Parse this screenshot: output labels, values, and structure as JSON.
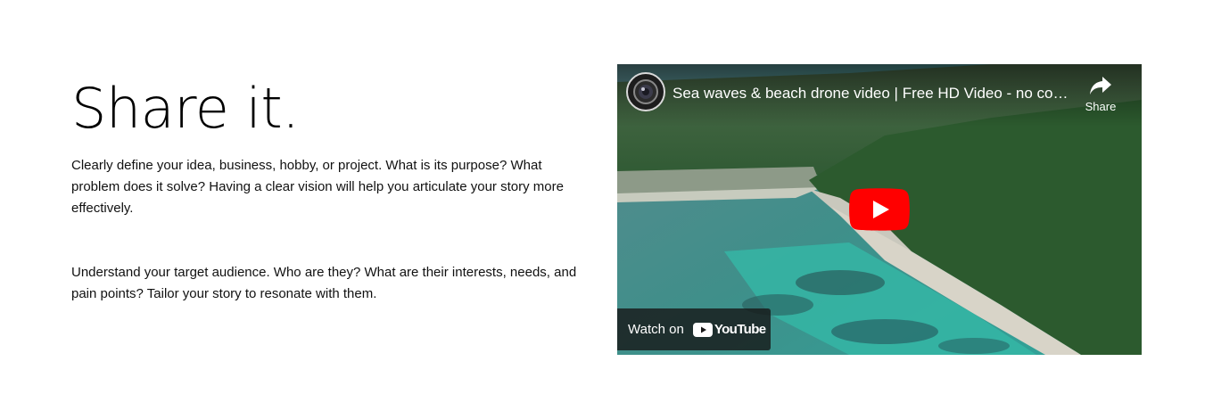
{
  "section": {
    "headline": "Share it.",
    "paragraphs": [
      "Clearly define your idea, business, hobby, or project. What is its purpose? What problem does it solve? Having a clear vision will help you articulate your story more effectively.",
      "Understand your target audience. Who are they? What are their interests, needs, and pain points? Tailor your story to resonate with them."
    ]
  },
  "video": {
    "title": "Sea waves & beach drone video | Free HD Video - no copyright",
    "share_label": "Share",
    "watch_on_label": "Watch on",
    "youtube_wordmark": "YouTube",
    "icons": {
      "channel": "channel-avatar-icon",
      "share": "share-arrow-icon",
      "play": "youtube-play-icon",
      "logo": "youtube-logo-icon"
    },
    "colors": {
      "play_red": "#ff0000",
      "overlay": "#171717"
    }
  }
}
